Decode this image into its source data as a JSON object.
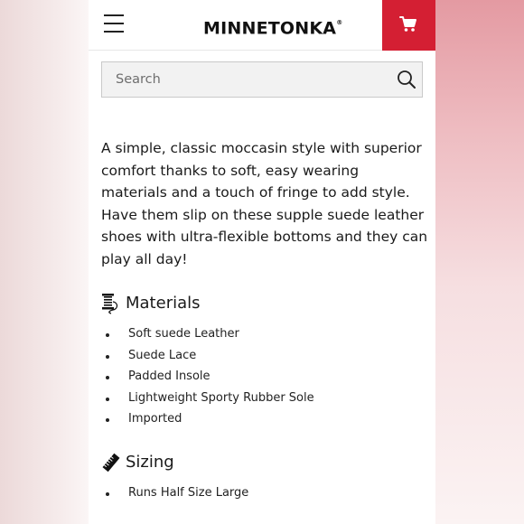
{
  "header": {
    "brand": "MINNETONKA",
    "brand_mark": "®",
    "menu_icon": "hamburger-menu-icon",
    "cart_icon": "shopping-cart-icon",
    "cart_color": "#d41f33"
  },
  "search": {
    "placeholder": "Search",
    "value": "",
    "icon": "search-icon"
  },
  "product": {
    "description": "A simple, classic moccasin style with superior comfort thanks to soft, easy wearing materials and a touch of fringe to add style. Have them slip on these supple suede leather shoes with ultra-flexible bottoms and they can play all day!"
  },
  "materials": {
    "title": "Materials",
    "icon": "thread-spool-icon",
    "items": [
      "Soft suede Leather",
      "Suede Lace",
      "Padded Insole",
      "Lightweight Sporty Rubber Sole",
      "Imported"
    ]
  },
  "sizing": {
    "title": "Sizing",
    "icon": "ruler-icon",
    "items": [
      "Runs Half Size Large"
    ]
  }
}
